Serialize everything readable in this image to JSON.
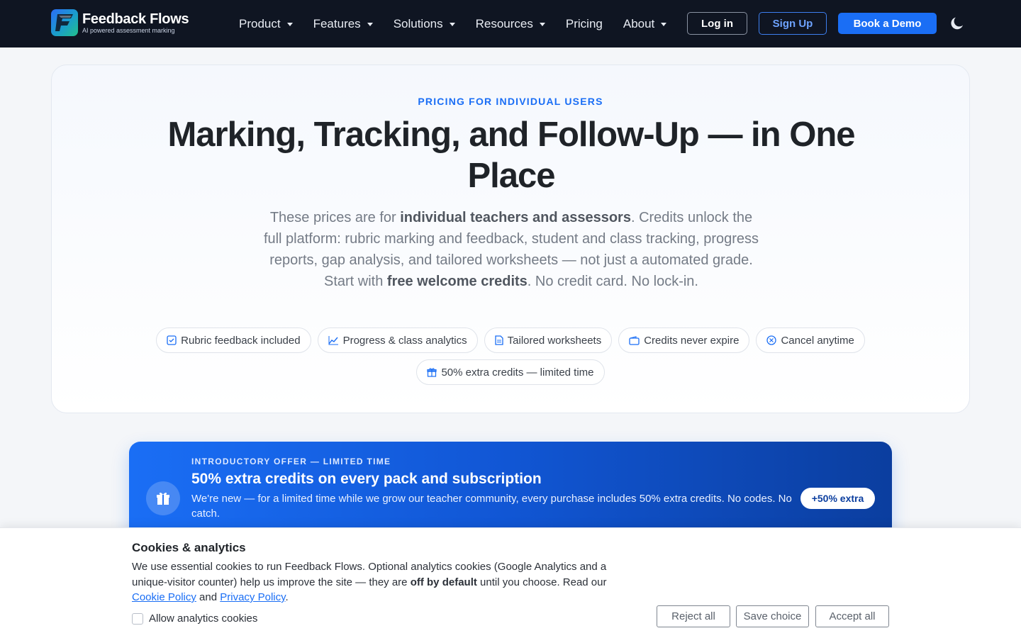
{
  "brand": {
    "name": "Feedback Flows",
    "tagline": "AI powered assessment marking"
  },
  "nav": {
    "items": [
      {
        "label": "Product",
        "dropdown": true
      },
      {
        "label": "Features",
        "dropdown": true
      },
      {
        "label": "Solutions",
        "dropdown": true
      },
      {
        "label": "Resources",
        "dropdown": true
      },
      {
        "label": "Pricing",
        "dropdown": false
      },
      {
        "label": "About",
        "dropdown": true
      }
    ],
    "login_label": "Log in",
    "signup_label": "Sign Up",
    "demo_label": "Book a Demo",
    "theme_icon": "moon-icon"
  },
  "hero": {
    "eyebrow": "PRICING FOR INDIVIDUAL USERS",
    "title": "Marking, Tracking, and Follow-Up — in One Place",
    "desc_parts": {
      "p1": "These prices are for ",
      "b1": "individual teachers and assessors",
      "p2": ". Credits unlock the full platform: rubric marking and feedback, student and class tracking, progress reports, gap analysis, and tailored worksheets — not just a automated grade. Start with ",
      "b2": "free welcome credits",
      "p3": ". No credit card. No lock-in."
    },
    "chips": [
      {
        "label": "Rubric feedback included",
        "icon": "checklist-icon"
      },
      {
        "label": "Progress & class analytics",
        "icon": "trend-chart-icon"
      },
      {
        "label": "Tailored worksheets",
        "icon": "document-icon"
      },
      {
        "label": "Credits never expire",
        "icon": "wallet-icon"
      },
      {
        "label": "Cancel anytime",
        "icon": "cancel-circle-icon"
      },
      {
        "label": "50% extra credits — limited time",
        "icon": "gift-icon"
      }
    ]
  },
  "promo": {
    "eyebrow": "INTRODUCTORY OFFER — LIMITED TIME",
    "title": "50% extra credits on every pack and subscription",
    "text": "We're new — for a limited time while we grow our teacher community, every purchase includes 50% extra credits. No codes. No catch.",
    "badge": "+50% extra"
  },
  "cookie": {
    "title": "Cookies & analytics",
    "text_p1": "We use essential cookies to run Feedback Flows. Optional analytics cookies (Google Analytics and a unique-visitor counter) help us improve the site — they are ",
    "text_bold": "off by default",
    "text_p2": " until you choose. Read our ",
    "cookie_policy": "Cookie Policy",
    "and": " and ",
    "privacy_policy": "Privacy Policy",
    "end": ".",
    "checkbox_label": "Allow analytics cookies",
    "checkbox_checked": false,
    "reject_label": "Reject all",
    "save_label": "Save choice",
    "accept_label": "Accept all"
  },
  "colors": {
    "nav_bg": "#0f1522",
    "accent": "#1a6ef5",
    "promo_end": "#0b3e9f"
  }
}
